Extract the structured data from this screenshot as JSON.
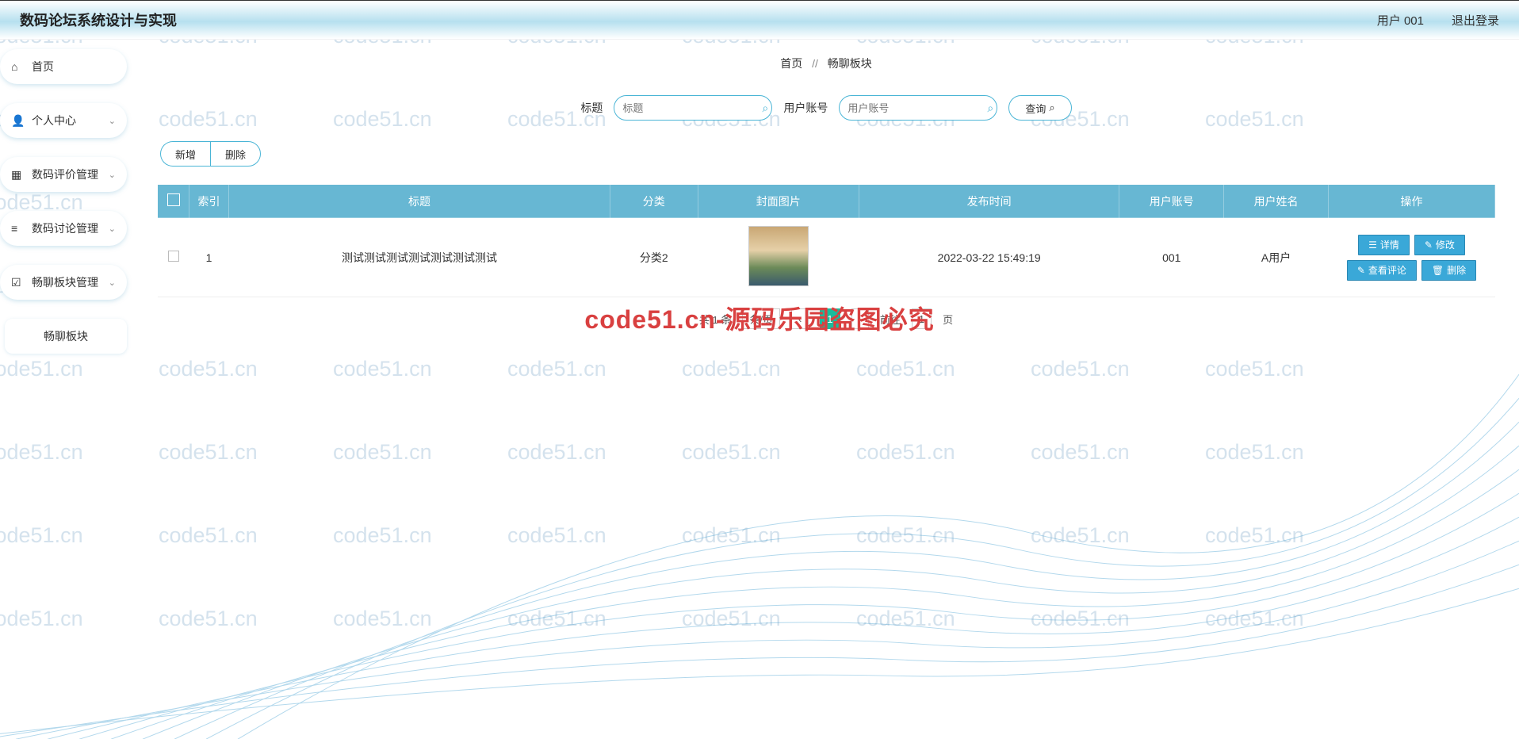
{
  "header": {
    "title": "数码论坛系统设计与实现",
    "user": "用户 001",
    "logout": "退出登录"
  },
  "sidebar": {
    "items": [
      {
        "label": "首页",
        "icon": "home",
        "expandable": false
      },
      {
        "label": "个人中心",
        "icon": "user",
        "expandable": true
      },
      {
        "label": "数码评价管理",
        "icon": "grid",
        "expandable": true
      },
      {
        "label": "数码讨论管理",
        "icon": "list",
        "expandable": true
      },
      {
        "label": "畅聊板块管理",
        "icon": "check",
        "expandable": true
      }
    ],
    "sub": {
      "label": "畅聊板块"
    }
  },
  "breadcrumb": {
    "home": "首页",
    "sep": "//",
    "current": "畅聊板块"
  },
  "search": {
    "label1": "标题",
    "ph1": "标题",
    "label2": "用户账号",
    "ph2": "用户账号",
    "query": "查询"
  },
  "actions": {
    "add": "新增",
    "del": "删除"
  },
  "table": {
    "cols": [
      "索引",
      "标题",
      "分类",
      "封面图片",
      "发布时间",
      "用户账号",
      "用户姓名",
      "操作"
    ],
    "rows": [
      {
        "idx": "1",
        "title": "测试测试测试测试测试测试测试",
        "cat": "分类2",
        "time": "2022-03-22 15:49:19",
        "acct": "001",
        "uname": "A用户"
      }
    ],
    "ops": {
      "detail": "详情",
      "edit": "修改",
      "comments": "查看评论",
      "delete": "删除"
    }
  },
  "pager": {
    "total": "共 1 条",
    "per": "条/页",
    "page": "1",
    "jump_prefix": "前往",
    "jump_suffix": "页"
  },
  "watermark": "code51.cn",
  "center_text": "code51.cn-源码乐园盗图必究"
}
